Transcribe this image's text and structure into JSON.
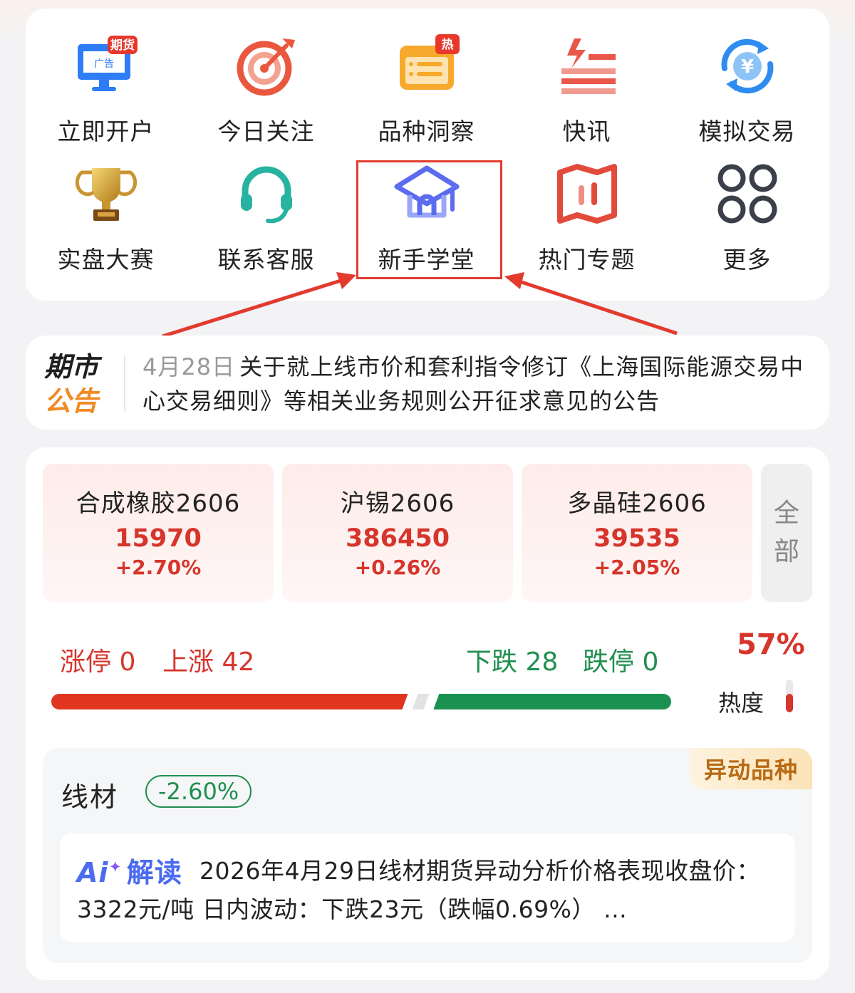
{
  "quick_grid": [
    {
      "label": "立即开户",
      "icon": "monitor-futures-ad-icon",
      "badge": "期货",
      "screen_text": "广告"
    },
    {
      "label": "今日关注",
      "icon": "target-icon"
    },
    {
      "label": "品种洞察",
      "icon": "insight-list-icon",
      "badge": "热"
    },
    {
      "label": "快讯",
      "icon": "flash-news-icon"
    },
    {
      "label": "模拟交易",
      "icon": "yuan-exchange-icon",
      "glyph": "¥"
    },
    {
      "label": "实盘大赛",
      "icon": "trophy-icon"
    },
    {
      "label": "联系客服",
      "icon": "headset-icon"
    },
    {
      "label": "新手学堂",
      "icon": "graduation-cap-icon"
    },
    {
      "label": "热门专题",
      "icon": "topic-map-icon"
    },
    {
      "label": "更多",
      "icon": "more-grid-icon"
    }
  ],
  "notice": {
    "logo_line1": "期市",
    "logo_line2": "公告",
    "date": "4月28日",
    "text": "关于就上线市价和套利指令修订《上海国际能源交易中心交易细则》等相关业务规则公开征求意见的公告"
  },
  "quotes": [
    {
      "name": "合成橡胶2606",
      "price": "15970",
      "change": "+2.70%"
    },
    {
      "name": "沪锡2606",
      "price": "386450",
      "change": "+0.26%"
    },
    {
      "name": "多晶硅2606",
      "price": "39535",
      "change": "+2.05%"
    }
  ],
  "all_button": {
    "line1": "全",
    "line2": "部"
  },
  "breadth": {
    "limit_up": "涨停 0",
    "up": "上涨 42",
    "down": "下跌 28",
    "limit_down": "跌停 0",
    "up_count": 42,
    "flat_count": 2,
    "down_count": 28,
    "heat_percent": "57%",
    "heat_label": "热度",
    "heat_level": 0.57,
    "colors": {
      "up": "#e0351f",
      "flat": "#e2e2e2",
      "down": "#1a9150"
    }
  },
  "abnormal": {
    "tag": "异动品种",
    "name": "线材",
    "change": "-2.60%",
    "ai_label_ai": "Ai",
    "ai_label_jd": "解读",
    "ai_text": "2026年4月29日线材期货异动分析价格表现收盘价：3322元/吨  日内波动：下跌23元（跌幅0.69%） …"
  }
}
